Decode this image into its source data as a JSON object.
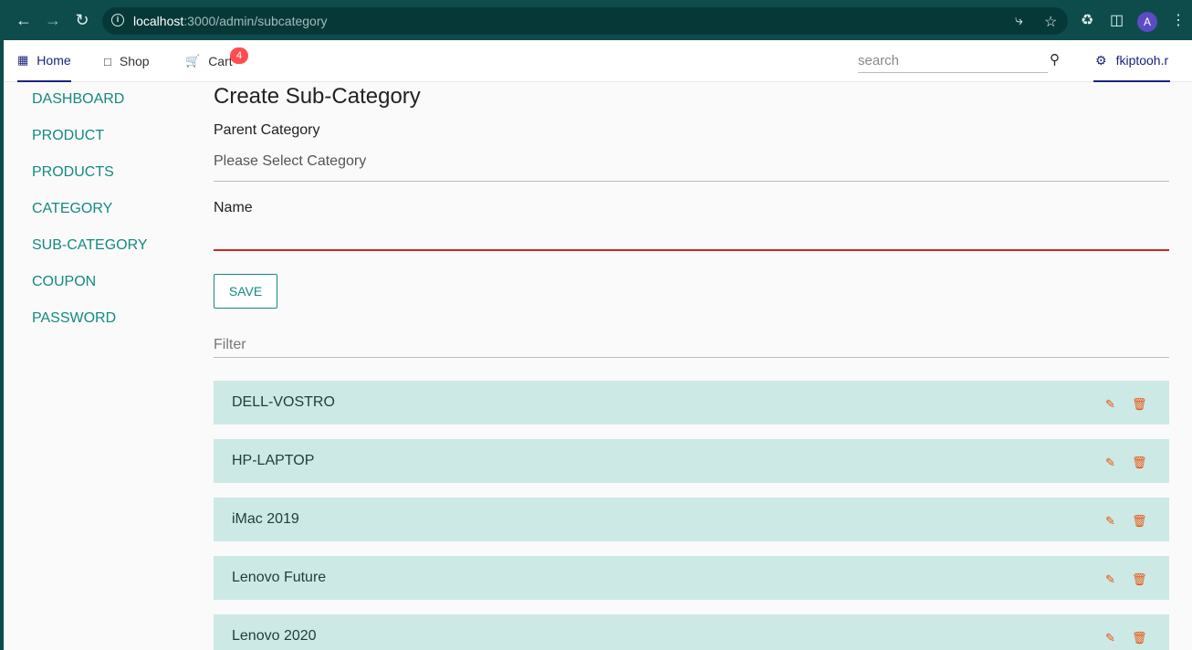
{
  "browser": {
    "url_host": "localhost",
    "url_path": ":3000/admin/subcategory",
    "avatar_letter": "A"
  },
  "nav": {
    "home": "Home",
    "shop": "Shop",
    "cart": "Cart",
    "cart_count": "4",
    "search_placeholder": "search",
    "user": "fkiptooh.r"
  },
  "sidebar": {
    "items": [
      "DASHBOARD",
      "PRODUCT",
      "PRODUCTS",
      "CATEGORY",
      "SUB-CATEGORY",
      "COUPON",
      "PASSWORD"
    ]
  },
  "form": {
    "title": "Create Sub-Category",
    "parent_label": "Parent Category",
    "parent_value": "Please Select Category",
    "name_label": "Name",
    "name_value": "",
    "save_label": "SAVE",
    "filter_placeholder": "Filter"
  },
  "subcategories": [
    "DELL-VOSTRO",
    "HP-LAPTOP",
    "iMac 2019",
    "Lenovo Future",
    "Lenovo 2020"
  ],
  "colors": {
    "accent": "#138a80",
    "nav_active": "#1a237e",
    "row_bg": "#cce9e5",
    "danger": "#e8540c",
    "error_underline": "#c62828"
  }
}
